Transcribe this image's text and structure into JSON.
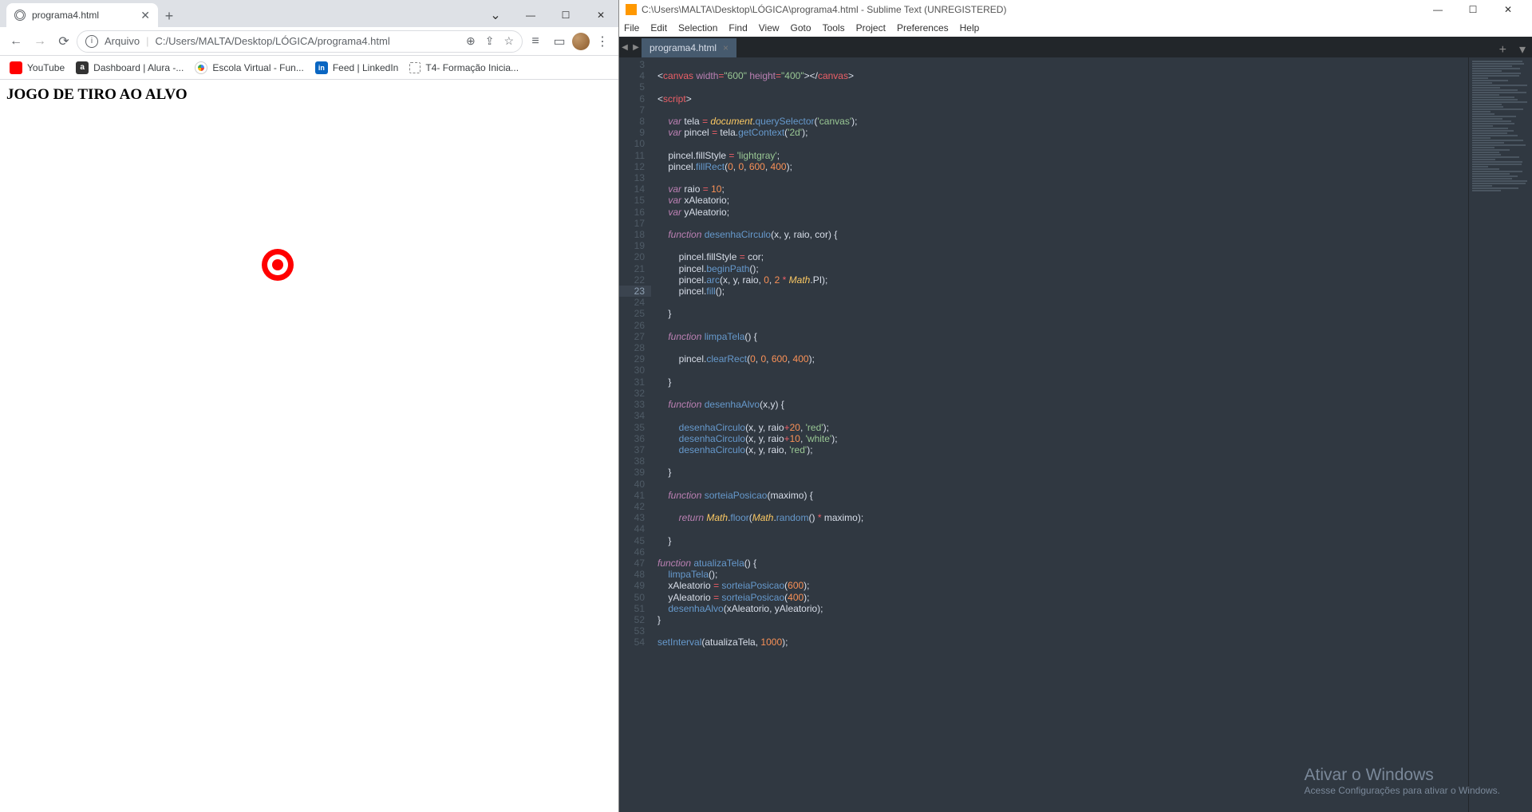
{
  "chrome": {
    "tab_title": "programa4.html",
    "new_tab": "+",
    "win": {
      "chev": "⌄",
      "min": "—",
      "max": "☐",
      "close": "✕"
    },
    "nav": {
      "back": "←",
      "fwd": "→",
      "reload": "⟳"
    },
    "omni_prefix": "Arquivo",
    "omni_path": "C:/Users/MALTA/Desktop/LÓGICA/programa4.html",
    "omni_icons": {
      "zoom": "⊕",
      "share": "⇪",
      "star": "☆",
      "readlist": "≡",
      "panel": "▭",
      "menu": "⋮"
    },
    "bookmarks": [
      {
        "ico": "yt",
        "label": "YouTube"
      },
      {
        "ico": "al",
        "glyph": "a",
        "label": "Dashboard | Alura -..."
      },
      {
        "ico": "ev",
        "label": "Escola Virtual - Fun..."
      },
      {
        "ico": "li",
        "glyph": "in",
        "label": "Feed | LinkedIn"
      },
      {
        "ico": "gen",
        "label": "T4- Formação Inicia..."
      }
    ],
    "page_heading": "JOGO DE TIRO AO ALVO"
  },
  "sublime": {
    "title_path": "C:\\Users\\MALTA\\Desktop\\LÓGICA\\programa4.html - Sublime Text (UNREGISTERED)",
    "menu": [
      "File",
      "Edit",
      "Selection",
      "Find",
      "View",
      "Goto",
      "Tools",
      "Project",
      "Preferences",
      "Help"
    ],
    "tab": "programa4.html",
    "line_start": 3,
    "line_end": 54,
    "highlight_line": 23,
    "watermark_title": "Ativar o Windows",
    "watermark_sub": "Acesse Configurações para ativar o Windows.",
    "code": [
      "",
      "<canvas width=\"600\" height=\"400\"></canvas>",
      "",
      "<script>",
      "",
      "    var tela = document.querySelector('canvas');",
      "    var pincel = tela.getContext('2d');",
      "",
      "    pincel.fillStyle = 'lightgray';",
      "    pincel.fillRect(0, 0, 600, 400);",
      "",
      "    var raio = 10;",
      "    var xAleatorio;",
      "    var yAleatorio;",
      "",
      "    function desenhaCirculo(x, y, raio, cor) {",
      "",
      "        pincel.fillStyle = cor;",
      "        pincel.beginPath();",
      "        pincel.arc(x, y, raio, 0, 2 * Math.PI);",
      "        pincel.fill();",
      "",
      "    }",
      "",
      "    function limpaTela() {",
      "",
      "        pincel.clearRect(0, 0, 600, 400);",
      "",
      "    }",
      "",
      "    function desenhaAlvo(x,y) {",
      "",
      "        desenhaCirculo(x, y, raio+20, 'red');",
      "        desenhaCirculo(x, y, raio+10, 'white');",
      "        desenhaCirculo(x, y, raio, 'red');",
      "",
      "    }",
      "",
      "    function sorteiaPosicao(maximo) {",
      "",
      "        return Math.floor(Math.random() * maximo);",
      "",
      "    }",
      "",
      "function atualizaTela() {",
      "    limpaTela();",
      "    xAleatorio = sorteiaPosicao(600);",
      "    yAleatorio = sorteiaPosicao(400);",
      "    desenhaAlvo(xAleatorio, yAleatorio);",
      "}",
      "",
      "setInterval(atualizaTela, 1000);"
    ]
  }
}
